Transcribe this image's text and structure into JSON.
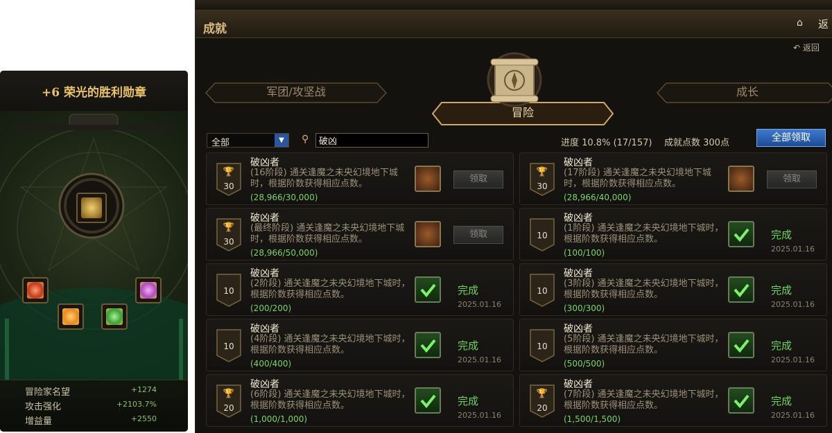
{
  "medal_panel": {
    "title": "+6 荣光的胜利勋章",
    "gems": [
      {
        "name": "center",
        "color": "#d4a02e"
      },
      {
        "name": "left-top",
        "color": "#d8543a"
      },
      {
        "name": "left-bottom",
        "color": "#e8a530"
      },
      {
        "name": "right-bottom",
        "color": "#4cb34a"
      },
      {
        "name": "right-top",
        "color": "#c060c8"
      }
    ],
    "stats": [
      {
        "label": "冒险家名望",
        "value": "+1274"
      },
      {
        "label": "攻击强化",
        "value": "+2103.7%"
      },
      {
        "label": "增益量",
        "value": "+2550"
      }
    ]
  },
  "window": {
    "title": "成就",
    "home_icon": "home-icon",
    "top_back_label": "返",
    "back_label": "返回",
    "tabs": {
      "left": "军团/攻坚战",
      "center": "冒险",
      "right": "成长"
    },
    "filter": {
      "selected": "全部"
    },
    "search": {
      "value": "破凶"
    },
    "progress": "进度  10.8% (17/157)",
    "points": "成就点数  300点",
    "claim_all_label": "全部领取"
  },
  "achievements": [
    {
      "badge": "30",
      "trophy": true,
      "title": "破凶者",
      "desc": "(16阶段) 通关逢魔之未央幻境地下城时，根据阶数获得相应点数。",
      "progress": "(28,966/30,000)",
      "state": "claim",
      "claim_label": "领取"
    },
    {
      "badge": "30",
      "trophy": true,
      "title": "破凶者",
      "desc": "(17阶段) 通关逢魔之未央幻境地下城时，根据阶数获得相应点数。",
      "progress": "(28,966/40,000)",
      "state": "claim",
      "claim_label": "领取"
    },
    {
      "badge": "30",
      "trophy": true,
      "title": "破凶者",
      "desc": "(最终阶段) 通关逢魔之未央幻境地下城时，根据阶数获得相应点数。",
      "progress": "(28,966/50,000)",
      "state": "claim",
      "claim_label": "领取"
    },
    {
      "badge": "10",
      "trophy": false,
      "title": "破凶者",
      "desc": "(1阶段) 通关逢魔之未央幻境地下城时，根据阶数获得相应点数。",
      "progress": "(100/100)",
      "state": "done",
      "status": "完成",
      "date": "2025.01.16"
    },
    {
      "badge": "10",
      "trophy": false,
      "title": "破凶者",
      "desc": "(2阶段) 通关逢魔之未央幻境地下城时，根据阶数获得相应点数。",
      "progress": "(200/200)",
      "state": "done",
      "status": "完成",
      "date": "2025.01.16"
    },
    {
      "badge": "10",
      "trophy": false,
      "title": "破凶者",
      "desc": "(3阶段) 通关逢魔之未央幻境地下城时，根据阶数获得相应点数。",
      "progress": "(300/300)",
      "state": "done",
      "status": "完成",
      "date": "2025.01.16"
    },
    {
      "badge": "10",
      "trophy": false,
      "title": "破凶者",
      "desc": "(4阶段) 通关逢魔之未央幻境地下城时，根据阶数获得相应点数。",
      "progress": "(400/400)",
      "state": "done",
      "status": "完成",
      "date": "2025.01.16"
    },
    {
      "badge": "10",
      "trophy": false,
      "title": "破凶者",
      "desc": "(5阶段) 通关逢魔之未央幻境地下城时，根据阶数获得相应点数。",
      "progress": "(500/500)",
      "state": "done",
      "status": "完成",
      "date": "2025.01.16"
    },
    {
      "badge": "20",
      "trophy": true,
      "title": "破凶者",
      "desc": "(6阶段) 通关逢魔之未央幻境地下城时，根据阶数获得相应点数。",
      "progress": "(1,000/1,000)",
      "state": "done",
      "status": "完成",
      "date": "2025.01.16"
    },
    {
      "badge": "20",
      "trophy": true,
      "title": "破凶者",
      "desc": "(7阶段) 通关逢魔之未央幻境地下城时，根据阶数获得相应点数。",
      "progress": "(1,500/1,500)",
      "state": "done",
      "status": "完成",
      "date": "2025.01.16"
    }
  ]
}
